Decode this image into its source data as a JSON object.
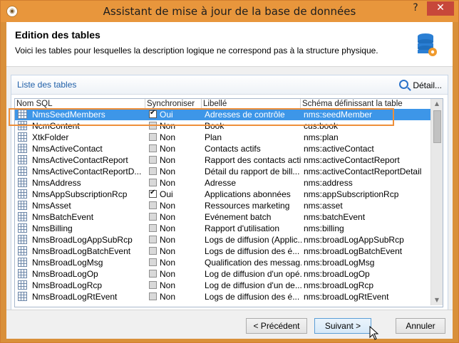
{
  "window": {
    "title": "Assistant de mise à jour de la base de données",
    "help_label": "?",
    "close_label": "✕"
  },
  "header": {
    "title": "Edition des tables",
    "description": "Voici les tables pour lesquelles la description logique ne correspond pas à la structure physique."
  },
  "panel": {
    "title": "Liste des tables",
    "detail_label": "Détail..."
  },
  "grid": {
    "columns": [
      "Nom SQL",
      "Synchroniser",
      "Libellé",
      "Schéma définissant la table"
    ],
    "rows": [
      {
        "name": "NmsSeedMembers",
        "sync": true,
        "sync_label": "Oui",
        "label": "Adresses de contrôle",
        "schema": "nms:seedMember"
      },
      {
        "name": "NcmContent",
        "sync": false,
        "sync_label": "Non",
        "label": "Book",
        "schema": "cus:book"
      },
      {
        "name": "XtkFolder",
        "sync": false,
        "sync_label": "Non",
        "label": "Plan",
        "schema": "nms:plan"
      },
      {
        "name": "NmsActiveContact",
        "sync": false,
        "sync_label": "Non",
        "label": "Contacts actifs",
        "schema": "nms:activeContact"
      },
      {
        "name": "NmsActiveContactReport",
        "sync": false,
        "sync_label": "Non",
        "label": "Rapport des contacts actifs",
        "schema": "nms:activeContactReport"
      },
      {
        "name": "NmsActiveContactReportD...",
        "sync": false,
        "sync_label": "Non",
        "label": "Détail du rapport de bill...",
        "schema": "nms:activeContactReportDetail"
      },
      {
        "name": "NmsAddress",
        "sync": false,
        "sync_label": "Non",
        "label": "Adresse",
        "schema": "nms:address"
      },
      {
        "name": "NmsAppSubscriptionRcp",
        "sync": true,
        "sync_label": "Oui",
        "label": "Applications abonnées",
        "schema": "nms:appSubscriptionRcp"
      },
      {
        "name": "NmsAsset",
        "sync": false,
        "sync_label": "Non",
        "label": "Ressources marketing",
        "schema": "nms:asset"
      },
      {
        "name": "NmsBatchEvent",
        "sync": false,
        "sync_label": "Non",
        "label": "Evénement batch",
        "schema": "nms:batchEvent"
      },
      {
        "name": "NmsBilling",
        "sync": false,
        "sync_label": "Non",
        "label": "Rapport d'utilisation",
        "schema": "nms:billing"
      },
      {
        "name": "NmsBroadLogAppSubRcp",
        "sync": false,
        "sync_label": "Non",
        "label": "Logs de diffusion (Applic...",
        "schema": "nms:broadLogAppSubRcp"
      },
      {
        "name": "NmsBroadLogBatchEvent",
        "sync": false,
        "sync_label": "Non",
        "label": "Logs de diffusion des é...",
        "schema": "nms:broadLogBatchEvent"
      },
      {
        "name": "NmsBroadLogMsg",
        "sync": false,
        "sync_label": "Non",
        "label": "Qualification des messag...",
        "schema": "nms:broadLogMsg"
      },
      {
        "name": "NmsBroadLogOp",
        "sync": false,
        "sync_label": "Non",
        "label": "Log de diffusion d'un opé...",
        "schema": "nms:broadLogOp"
      },
      {
        "name": "NmsBroadLogRcp",
        "sync": false,
        "sync_label": "Non",
        "label": "Log de diffusion d'un de...",
        "schema": "nms:broadLogRcp"
      },
      {
        "name": "NmsBroadLogRtEvent",
        "sync": false,
        "sync_label": "Non",
        "label": "Logs de diffusion des é...",
        "schema": "nms:broadLogRtEvent"
      }
    ]
  },
  "footer": {
    "prev_label": "< Précédent",
    "next_label": "Suivant >",
    "cancel_label": "Annuler"
  }
}
